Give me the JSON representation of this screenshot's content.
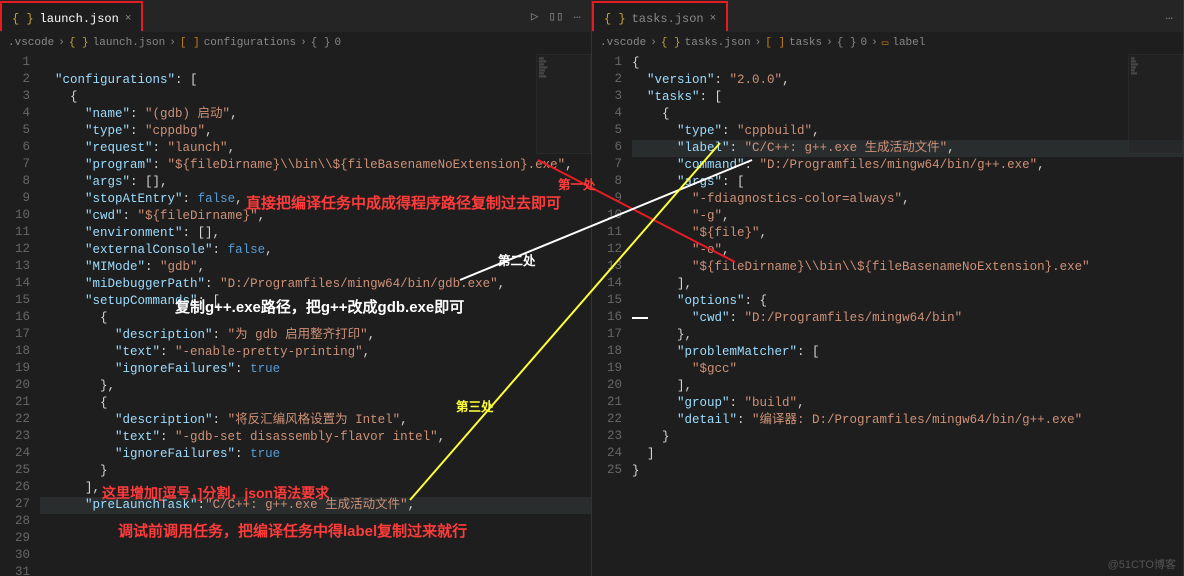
{
  "tabs": {
    "left": {
      "name": "launch.json",
      "icon": "{ }"
    },
    "right": {
      "name": "tasks.json",
      "icon": "{ }"
    },
    "close": "×"
  },
  "actions": {
    "run": "▷",
    "split": "▯▯",
    "more": "…"
  },
  "breadcrumb_left": {
    "folder": ".vscode",
    "sep": "›",
    "file": "launch.json",
    "arr": "[ ]",
    "seg": "configurations",
    "brace": "{ }",
    "idx": "0"
  },
  "breadcrumb_right": {
    "folder": ".vscode",
    "sep": "›",
    "file": "tasks.json",
    "arr": "[ ]",
    "seg": "tasks",
    "brace": "{ }",
    "idx": "0",
    "labicon": "▭",
    "lab": "label"
  },
  "left_lines": [
    "",
    "  <span class='k'>\"configurations\"</span><span class='p'>: [</span>",
    "    <span class='p'>{</span>",
    "      <span class='k'>\"name\"</span><span class='p'>: </span><span class='s'>\"(gdb) 启动\"</span><span class='p'>,</span>",
    "      <span class='k'>\"type\"</span><span class='p'>: </span><span class='s'>\"cppdbg\"</span><span class='p'>,</span>",
    "      <span class='k'>\"request\"</span><span class='p'>: </span><span class='s'>\"launch\"</span><span class='p'>,</span>",
    "      <span class='k'>\"program\"</span><span class='p'>: </span><span class='s'>\"${fileDirname}\\\\bin\\\\${fileBasenameNoExtension}.exe\"</span><span class='p'>,</span>",
    "      <span class='k'>\"args\"</span><span class='p'>: [],</span>",
    "      <span class='k'>\"stopAtEntry\"</span><span class='p'>: </span><span class='b'>false</span><span class='p'>,</span>",
    "      <span class='k'>\"cwd\"</span><span class='p'>: </span><span class='s'>\"${fileDirname}\"</span><span class='p'>,</span>",
    "      <span class='k'>\"environment\"</span><span class='p'>: [],</span>",
    "      <span class='k'>\"externalConsole\"</span><span class='p'>: </span><span class='b'>false</span><span class='p'>,</span>",
    "      <span class='k'>\"MIMode\"</span><span class='p'>: </span><span class='s'>\"gdb\"</span><span class='p'>,</span>",
    "      <span class='k'>\"miDebuggerPath\"</span><span class='p'>: </span><span class='s'>\"D:/Programfiles/mingw64/bin/gdb.exe\"</span><span class='p'>,</span>",
    "      <span class='k'>\"setupCommands\"</span><span class='p'>: [</span>",
    "        <span class='p'>{</span>",
    "          <span class='k'>\"description\"</span><span class='p'>: </span><span class='s'>\"为 gdb 启用整齐打印\"</span><span class='p'>,</span>",
    "          <span class='k'>\"text\"</span><span class='p'>: </span><span class='s'>\"-enable-pretty-printing\"</span><span class='p'>,</span>",
    "          <span class='k'>\"ignoreFailures\"</span><span class='p'>: </span><span class='b'>true</span>",
    "        <span class='p'>},</span>",
    "        <span class='p'>{</span>",
    "          <span class='k'>\"description\"</span><span class='p'>: </span><span class='s'>\"将反汇编风格设置为 Intel\"</span><span class='p'>,</span>",
    "          <span class='k'>\"text\"</span><span class='p'>: </span><span class='s'>\"-gdb-set disassembly-flavor intel\"</span><span class='p'>,</span>",
    "          <span class='k'>\"ignoreFailures\"</span><span class='p'>: </span><span class='b'>true</span>",
    "        <span class='p'>}</span>",
    "      <span class='p'>],</span>",
    "      <span class='k'>\"preLaunchTask\"</span><span class='p'>:</span><span class='s'>\"C/C++: g++.exe 生成活动文件\"</span><span class='p'>,</span>",
    "",
    "",
    "",
    ""
  ],
  "right_lines": [
    "<span class='p'>{</span>",
    "  <span class='k'>\"version\"</span><span class='p'>: </span><span class='s'>\"2.0.0\"</span><span class='p'>,</span>",
    "  <span class='k'>\"tasks\"</span><span class='p'>: [</span>",
    "    <span class='p'>{</span>",
    "      <span class='k'>\"type\"</span><span class='p'>: </span><span class='s'>\"cppbuild\"</span><span class='p'>,</span>",
    "      <span class='k'>\"label\"</span><span class='p'>: </span><span class='s'>\"C/C++: g++.exe 生成活动文件\"</span><span class='p'>,</span>",
    "      <span class='k'>\"command\"</span><span class='p'>: </span><span class='s'>\"D:/Programfiles/mingw64/bin/g++.exe\"</span><span class='p'>,</span>",
    "      <span class='k'>\"args\"</span><span class='p'>: [</span>",
    "        <span class='s'>\"-fdiagnostics-color=always\"</span><span class='p'>,</span>",
    "        <span class='s'>\"-g\"</span><span class='p'>,</span>",
    "        <span class='s'>\"${file}\"</span><span class='p'>,</span>",
    "        <span class='s'>\"-o\"</span><span class='p'>,</span>",
    "        <span class='s'>\"${fileDirname}\\\\bin\\\\${fileBasenameNoExtension}.exe\"</span>",
    "      <span class='p'>],</span>",
    "      <span class='k'>\"options\"</span><span class='p'>: {</span>",
    "        <span class='k'>\"cwd\"</span><span class='p'>: </span><span class='s'>\"D:/Programfiles/mingw64/bin\"</span>",
    "      <span class='p'>},</span>",
    "      <span class='k'>\"problemMatcher\"</span><span class='p'>: [</span>",
    "        <span class='s'>\"$gcc\"</span>",
    "      <span class='p'>],</span>",
    "      <span class='k'>\"group\"</span><span class='p'>: </span><span class='s'>\"build\"</span><span class='p'>,</span>",
    "      <span class='k'>\"detail\"</span><span class='p'>: </span><span class='s'>\"编译器: D:/Programfiles/mingw64/bin/g++.exe\"</span>",
    "    <span class='p'>}</span>",
    "  <span class='p'>]</span>",
    "<span class='p'>}</span>"
  ],
  "annotations": {
    "a1_label": "第一处",
    "a1_text": "直接把编译任务中成成得程序路径复制过去即可",
    "a2_label": "第二处",
    "a2_text": "复制g++.exe路径，把g++改成gdb.exe即可",
    "a3_label": "第三处",
    "a4_text": "这里增加[逗号，]分割，json语法要求",
    "a5_text": "调试前调用任务，把编译任务中得label复制过来就行"
  },
  "watermark": "@51CTO博客"
}
